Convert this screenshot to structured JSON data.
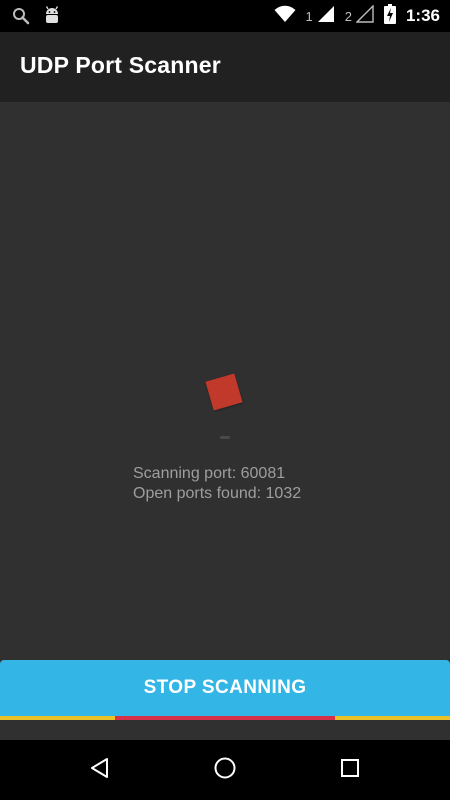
{
  "status_bar": {
    "left_icons": [
      "search-icon",
      "android-debug-icon"
    ],
    "sim1_label": "1",
    "sim2_label": "2",
    "time": "1:36",
    "right_icons": [
      "wifi-icon",
      "signal-icon",
      "signal-empty-icon",
      "battery-charging-icon"
    ]
  },
  "app_bar": {
    "title": "UDP Port Scanner"
  },
  "scan": {
    "scanning_port": "Scanning port: 60081",
    "open_ports": "Open ports found: 1032"
  },
  "stop_button": {
    "label": "STOP SCANNING"
  },
  "colors": {
    "accent": "#33b5e5",
    "spinner": "#c0392b",
    "progress_track": "#e8c227",
    "progress_indicator": "#d9304a"
  },
  "nav_bar": {
    "icons": [
      "back-icon",
      "home-icon",
      "recents-icon"
    ]
  }
}
